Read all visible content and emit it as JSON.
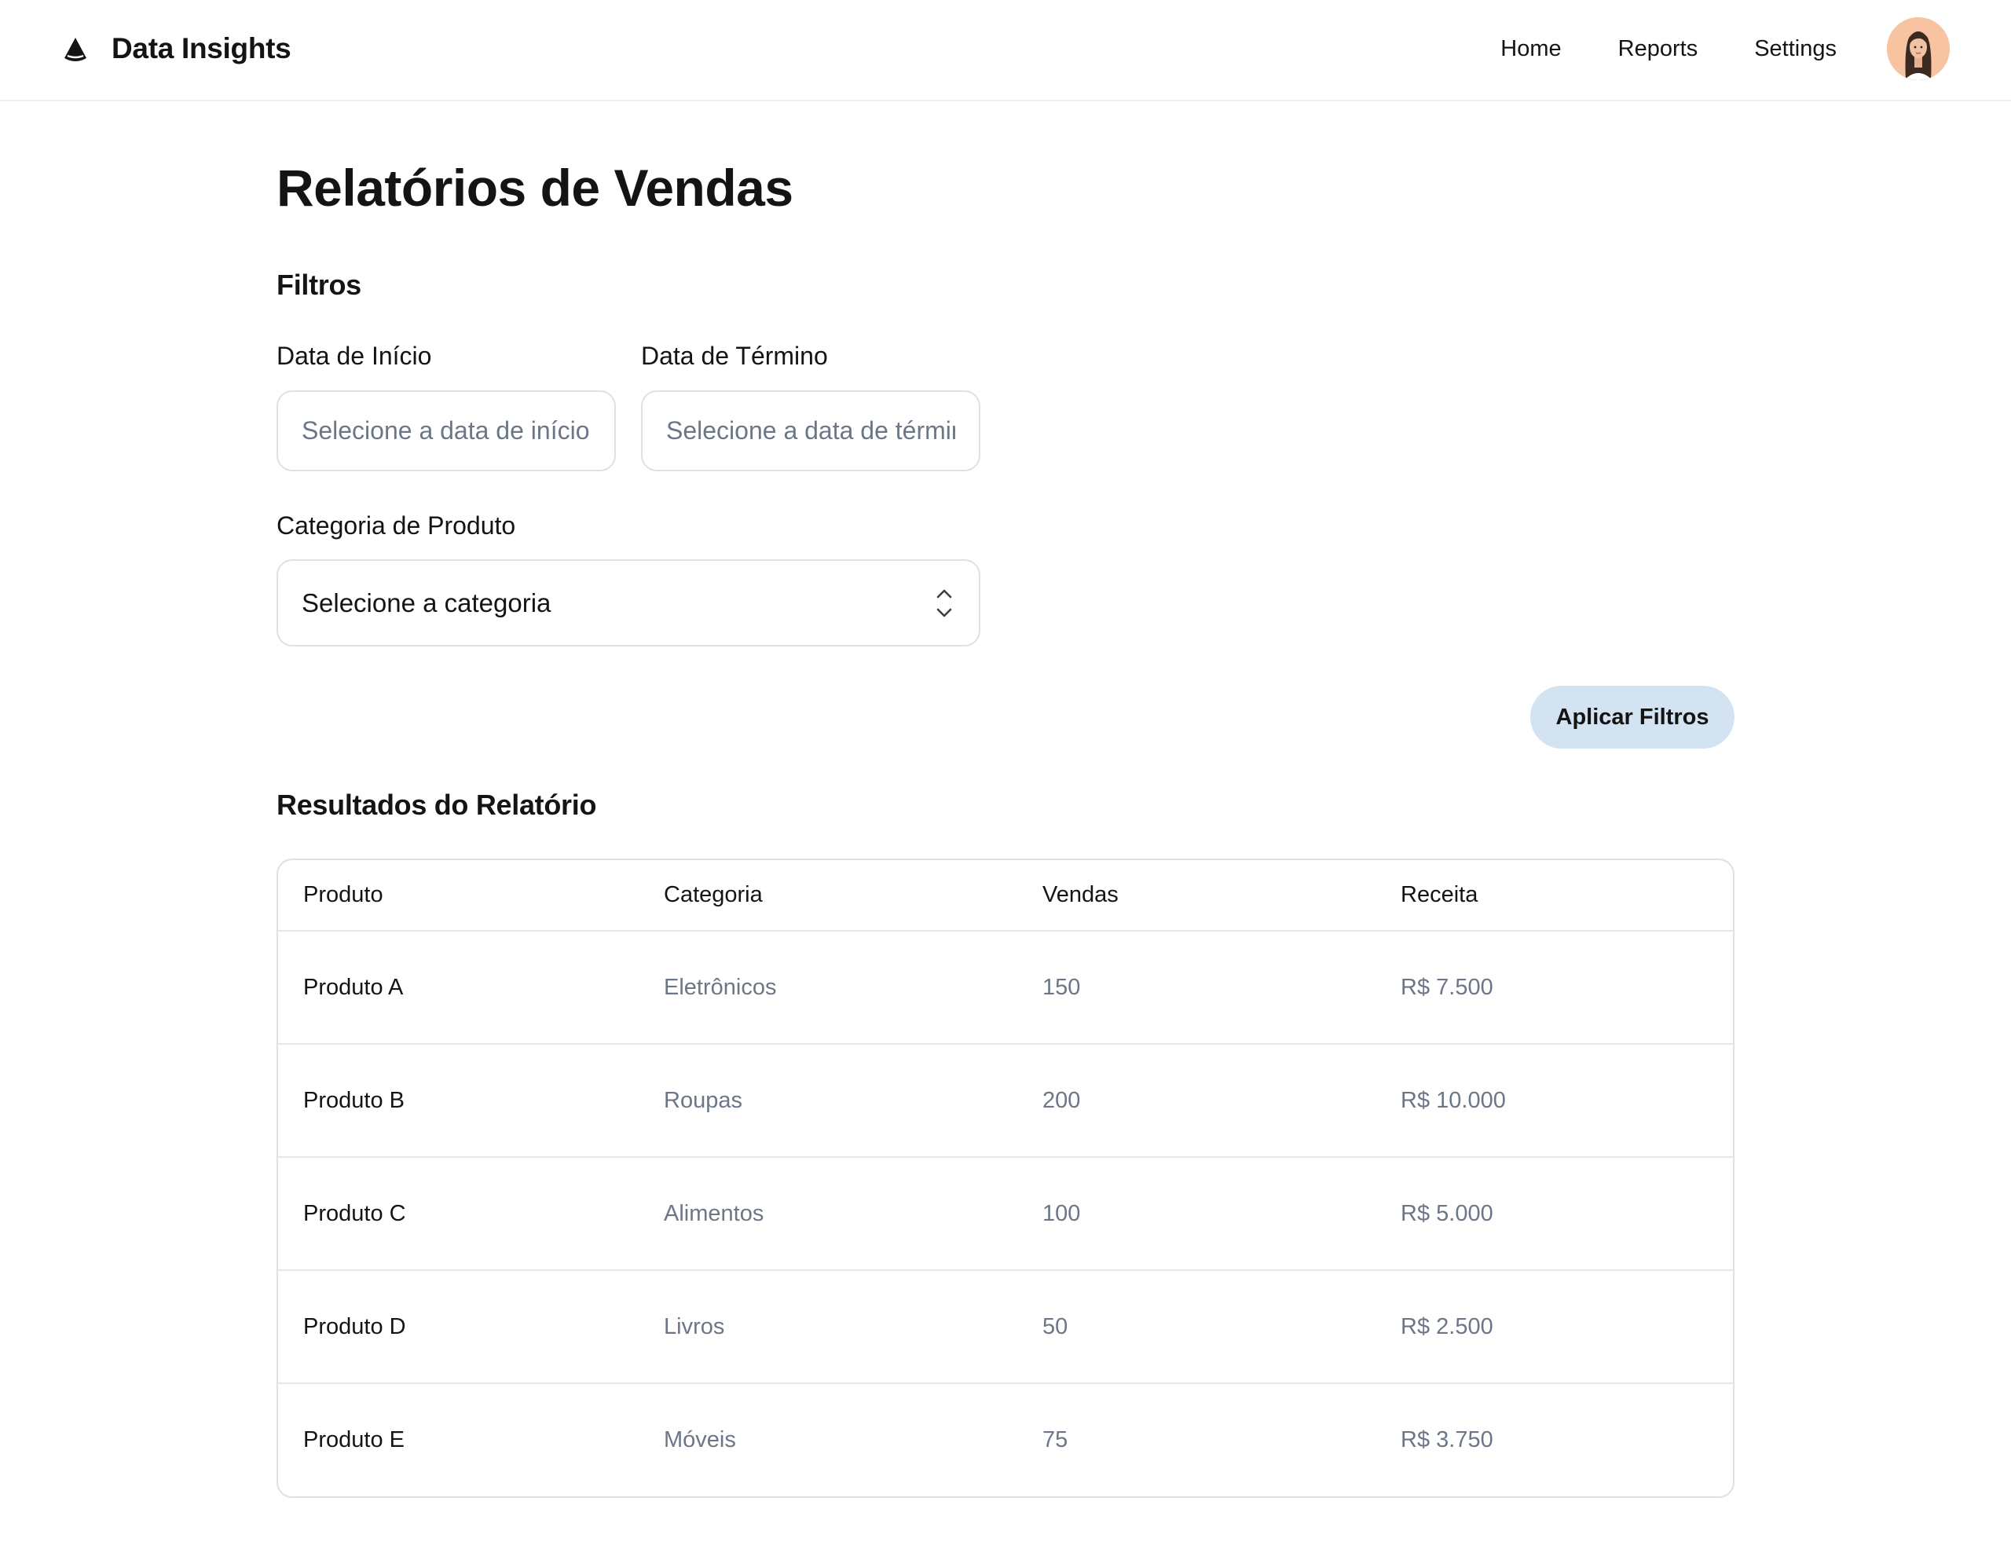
{
  "app": {
    "name": "Data Insights",
    "logo_icon": "triangle-logo-icon"
  },
  "nav": {
    "items": [
      {
        "label": "Home"
      },
      {
        "label": "Reports"
      },
      {
        "label": "Settings"
      }
    ],
    "avatar_icon": "user-avatar"
  },
  "page": {
    "title": "Relatórios de Vendas"
  },
  "filters": {
    "title": "Filtros",
    "start_date": {
      "label": "Data de Início",
      "placeholder": "Selecione a data de início",
      "value": ""
    },
    "end_date": {
      "label": "Data de Término",
      "placeholder": "Selecione a data de término",
      "value": ""
    },
    "category": {
      "label": "Categoria de Produto",
      "selected": "Selecione a categoria",
      "icon": "chevron-up-down-icon"
    },
    "apply_label": "Aplicar Filtros"
  },
  "results": {
    "title": "Resultados do Relatório",
    "columns": [
      "Produto",
      "Categoria",
      "Vendas",
      "Receita"
    ],
    "rows": [
      {
        "product": "Produto A",
        "category": "Eletrônicos",
        "sales": "150",
        "revenue": "R$ 7.500"
      },
      {
        "product": "Produto B",
        "category": "Roupas",
        "sales": "200",
        "revenue": "R$ 10.000"
      },
      {
        "product": "Produto C",
        "category": "Alimentos",
        "sales": "100",
        "revenue": "R$ 5.000"
      },
      {
        "product": "Produto D",
        "category": "Livros",
        "sales": "50",
        "revenue": "R$ 2.500"
      },
      {
        "product": "Produto E",
        "category": "Móveis",
        "sales": "75",
        "revenue": "R$ 3.750"
      }
    ]
  },
  "colors": {
    "accent_button": "#d3e3f1",
    "text_primary": "#141414",
    "text_muted": "#6b7787",
    "border": "#dde1e6"
  }
}
